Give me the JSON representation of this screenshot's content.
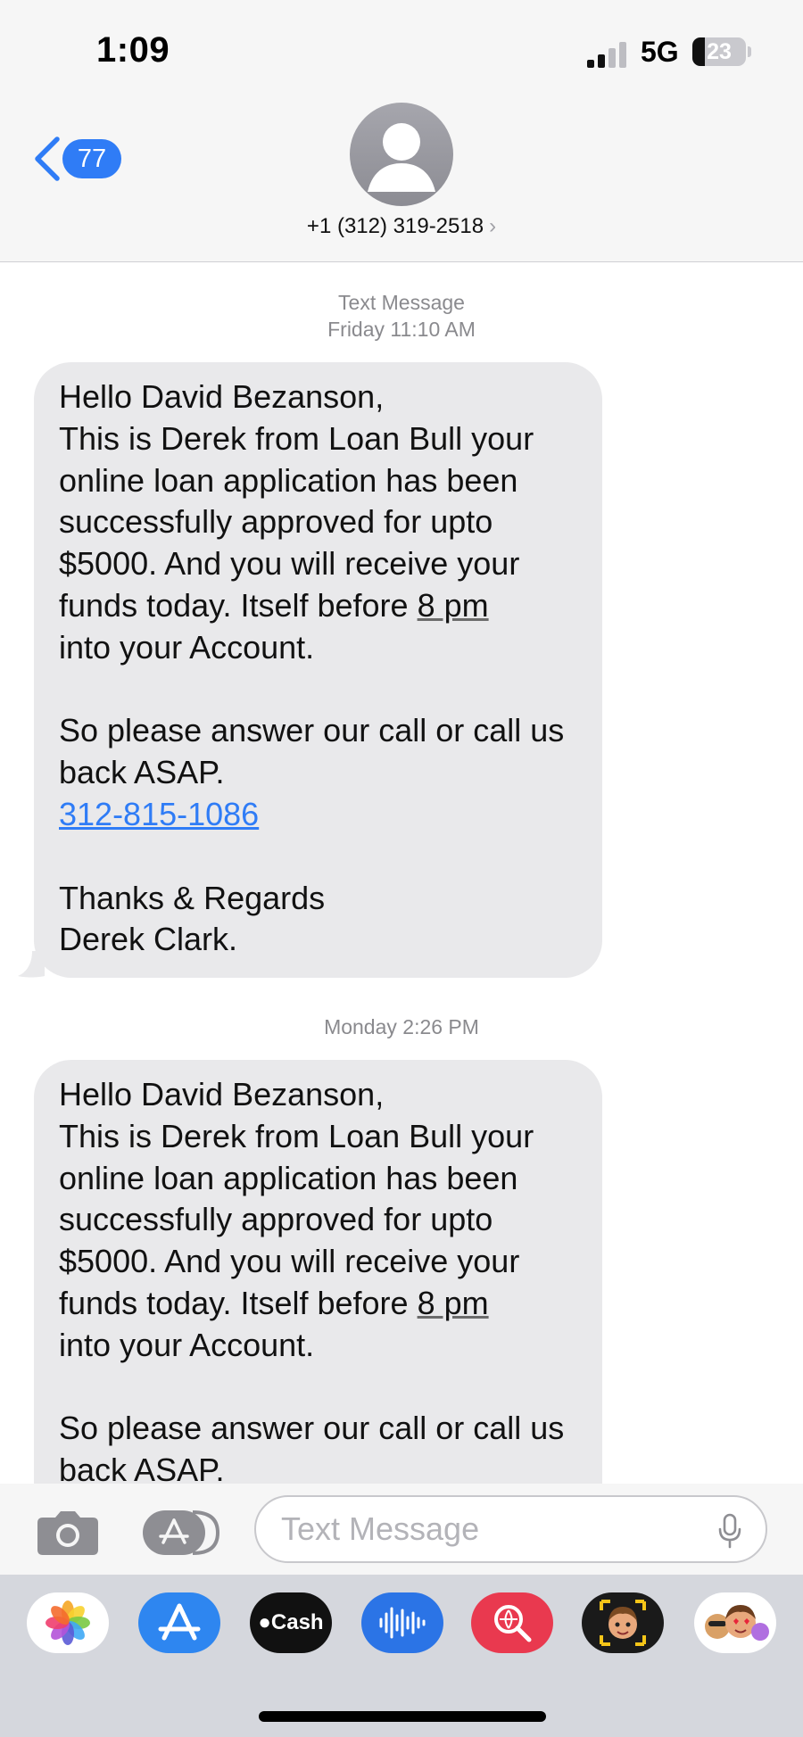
{
  "status_bar": {
    "time": "1:09",
    "network": "5G",
    "battery": "23",
    "battery_level_percent": 23
  },
  "header": {
    "back_badge": "77",
    "contact_number": "+1 (312) 319-2518",
    "contact_chevron": "›"
  },
  "messages": [
    {
      "timestamp_label": "Text Message",
      "timestamp_time": "Friday 11:10 AM",
      "line1": "Hello David Bezanson,\nThis is Derek from Loan Bull your online loan application has been successfully approved for upto $5000. And you will receive your funds today. Itself before ",
      "underline_text": "8 pm",
      "line2": "\ninto your Account.\n\nSo please answer our call or call us back ASAP.\n",
      "phone_link": "312-815-1086",
      "line3": "\n\nThanks & Regards\nDerek Clark."
    },
    {
      "timestamp_time": "Monday 2:26 PM",
      "line1": "Hello David Bezanson,\nThis is Derek from Loan Bull your online loan application has been successfully approved for upto $5000. And you will receive your funds today. Itself before ",
      "underline_text": "8 pm",
      "line2": "\ninto your Account.\n\nSo please answer our call or call us back ASAP."
    }
  ],
  "input_bar": {
    "placeholder": "Text Message"
  },
  "app_drawer": {
    "apps": [
      {
        "name": "photos-icon"
      },
      {
        "name": "app-store-icon"
      },
      {
        "name": "apple-cash-icon",
        "label": "Cash"
      },
      {
        "name": "audio-message-icon"
      },
      {
        "name": "images-search-icon"
      },
      {
        "name": "memoji-icon"
      },
      {
        "name": "memoji-stickers-icon"
      }
    ]
  },
  "colors": {
    "accent": "#2f7cf6",
    "bubble_received": "#e9e9eb",
    "background": "#ffffff",
    "timestamp": "#8a8a8e"
  }
}
